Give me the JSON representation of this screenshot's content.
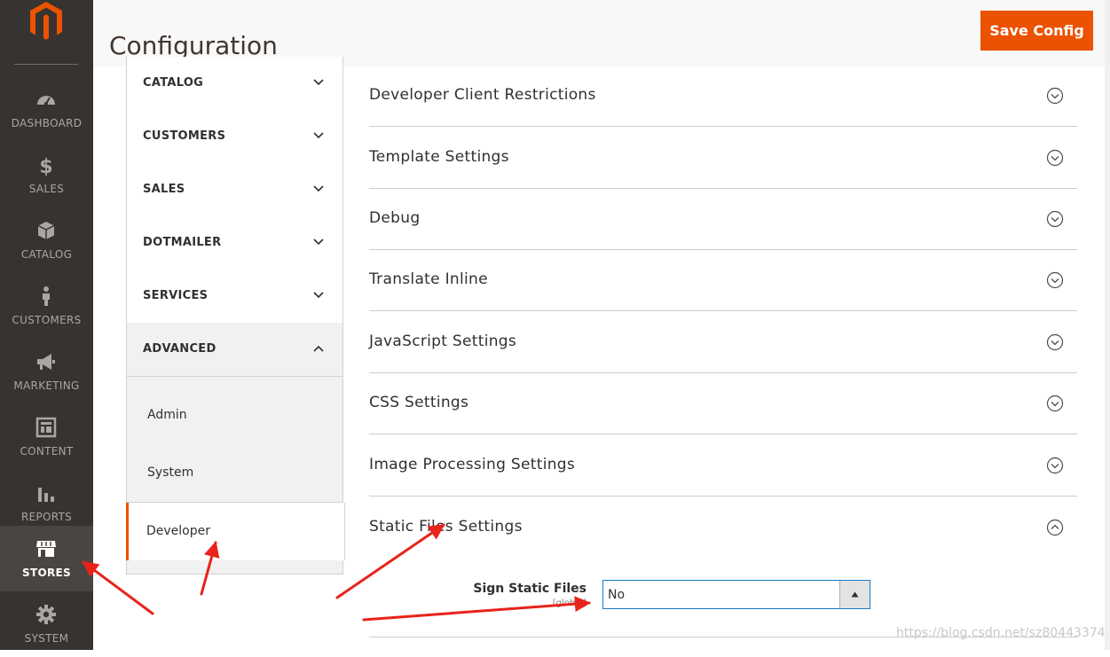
{
  "nav": {
    "items": [
      {
        "label": "DASHBOARD",
        "icon": "dashboard-icon"
      },
      {
        "label": "SALES",
        "icon": "dollar-icon"
      },
      {
        "label": "CATALOG",
        "icon": "box-icon"
      },
      {
        "label": "CUSTOMERS",
        "icon": "person-icon"
      },
      {
        "label": "MARKETING",
        "icon": "megaphone-icon"
      },
      {
        "label": "CONTENT",
        "icon": "layout-icon"
      },
      {
        "label": "REPORTS",
        "icon": "bar-chart-icon"
      },
      {
        "label": "STORES",
        "icon": "storefront-icon"
      },
      {
        "label": "SYSTEM",
        "icon": "gear-icon"
      }
    ],
    "active": "STORES"
  },
  "header": {
    "title": "Configuration",
    "save_label": "Save Config"
  },
  "tabs": {
    "groups": [
      "CATALOG",
      "CUSTOMERS",
      "SALES",
      "DOTMAILER",
      "SERVICES",
      "ADVANCED"
    ],
    "advanced_items": [
      "Admin",
      "System",
      "Developer"
    ],
    "active_item": "Developer"
  },
  "sections": [
    "Developer Client Restrictions",
    "Template Settings",
    "Debug",
    "Translate Inline",
    "JavaScript Settings",
    "CSS Settings",
    "Image Processing Settings",
    "Static Files Settings"
  ],
  "field": {
    "label": "Sign Static Files",
    "scope": "[global]",
    "value": "No"
  },
  "watermark": "https://blog.csdn.net/sz80443374",
  "colors": {
    "accent": "#eb5202",
    "nav_bg": "#373330",
    "annotation": "#e8231b"
  }
}
